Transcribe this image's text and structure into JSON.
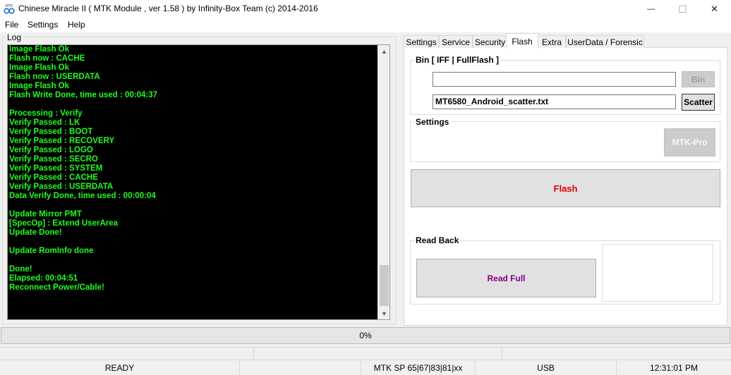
{
  "window": {
    "title": "Chinese Miracle II ( MTK Module , ver 1.58 ) by Infinity-Box Team (c) 2014-2016",
    "app_icon_text": "MTK",
    "minimize_glyph": "—",
    "maximize_glyph": "☐",
    "close_glyph": "✕"
  },
  "menu": {
    "file": "File",
    "settings": "Settings",
    "help": "Help"
  },
  "log": {
    "label": "Log",
    "lines": [
      "Image Flash Ok",
      "Flash now : CACHE",
      "Image Flash Ok",
      "Flash now : USERDATA",
      "Image Flash Ok",
      "Flash Write Done, time used : 00:04:37",
      "",
      "Processing : Verify",
      "Verify Passed : LK",
      "Verify Passed : BOOT",
      "Verify Passed : RECOVERY",
      "Verify Passed : LOGO",
      "Verify Passed : SECRO",
      "Verify Passed : SYSTEM",
      "Verify Passed : CACHE",
      "Verify Passed : USERDATA",
      "Data Verify Done, time used : 00:00:04",
      "",
      "Update Mirror PMT",
      "[SpecOp] : Extend UserArea",
      "Update Done!",
      "",
      "Update RomInfo done",
      "",
      "Done!",
      "Elapsed: 00:04:51",
      "Reconnect Power/Cable!"
    ],
    "scroll_up_glyph": "▲",
    "scroll_down_glyph": "▼"
  },
  "tabs": [
    "Settings",
    "Service",
    "Security",
    "Flash",
    "Extra",
    "UserData / Forensic"
  ],
  "active_tab": "Flash",
  "flash_panel": {
    "bin_group_title": "Bin  [ IFF | FullFlash ]",
    "bin_path_value": "",
    "bin_button": "Bin",
    "scatter_value": "MT6580_Android_scatter.txt",
    "scatter_button": "Scatter",
    "settings_group_title": "Settings",
    "mtk_pro_button": "MTK-Pro",
    "flash_button": "Flash",
    "flash_button_color": "#e00000",
    "read_back_group_title": "Read Back",
    "read_full_button": "Read Full",
    "read_full_color": "#800080"
  },
  "progress": {
    "text": "0%",
    "value": 0
  },
  "status": {
    "ready": "READY",
    "sp_info": "MTK SP 65|67|83|81|xx",
    "connection": "USB",
    "time": "12:31:01 PM"
  },
  "colors": {
    "console_bg": "#000000",
    "console_text": "#1dff1d"
  }
}
